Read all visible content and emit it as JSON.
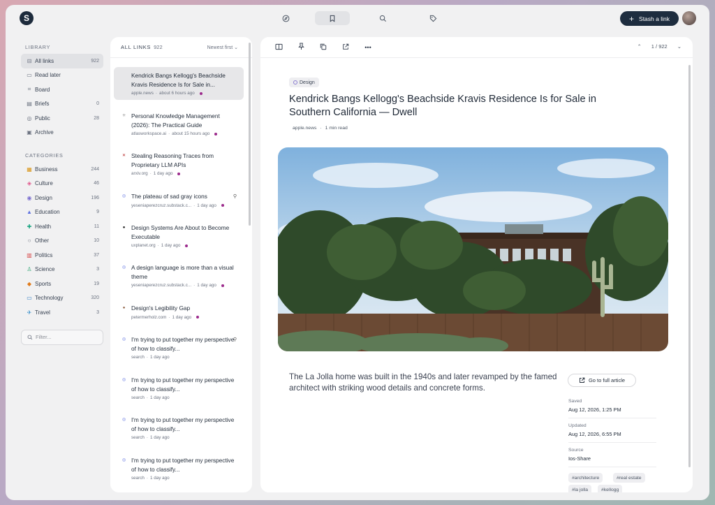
{
  "topbar": {
    "logo": "S",
    "nav_icons": [
      "compass-icon",
      "bookmark-icon",
      "search-icon",
      "tag-icon"
    ],
    "stash_label": "Stash a link"
  },
  "sidebar": {
    "library_title": "LIBRARY",
    "library": [
      {
        "label": "All links",
        "count": "922",
        "icon": "⊟",
        "active": true
      },
      {
        "label": "Read later",
        "count": "",
        "icon": "▭"
      },
      {
        "label": "Board",
        "count": "",
        "icon": "⌗"
      },
      {
        "label": "Briefs",
        "count": "0",
        "icon": "▤"
      },
      {
        "label": "Public",
        "count": "28",
        "icon": "◎"
      },
      {
        "label": "Archive",
        "count": "",
        "icon": "▣"
      }
    ],
    "categories_title": "CATEGORIES",
    "categories": [
      {
        "label": "Business",
        "count": "244",
        "icon": "▦",
        "color": "#d9961a"
      },
      {
        "label": "Culture",
        "count": "46",
        "icon": "◈",
        "color": "#e0548a"
      },
      {
        "label": "Design",
        "count": "196",
        "icon": "◉",
        "color": "#7b6fd0"
      },
      {
        "label": "Education",
        "count": "9",
        "icon": "▲",
        "color": "#5b6fe0"
      },
      {
        "label": "Health",
        "count": "11",
        "icon": "✚",
        "color": "#16a37f"
      },
      {
        "label": "Other",
        "count": "10",
        "icon": "○",
        "color": "#6b7280"
      },
      {
        "label": "Politics",
        "count": "37",
        "icon": "▥",
        "color": "#d64545"
      },
      {
        "label": "Science",
        "count": "3",
        "icon": "♙",
        "color": "#22a06b"
      },
      {
        "label": "Sports",
        "count": "19",
        "icon": "◆",
        "color": "#e07a1a"
      },
      {
        "label": "Technology",
        "count": "320",
        "icon": "▭",
        "color": "#3b82c4"
      },
      {
        "label": "Travel",
        "count": "3",
        "icon": "✈",
        "color": "#2f8bc9"
      }
    ],
    "filter_placeholder": "Filter..."
  },
  "list": {
    "title": "ALL LINKS",
    "count": "922",
    "sort": "Newest first",
    "items": [
      {
        "title": "Kendrick Bangs Kellogg's Beachside Kravis Residence Is for Sale in...",
        "source": "apple.news",
        "time": "about 6 hours ago",
        "dot": true,
        "fav": "",
        "fav_color": "#111",
        "active": true
      },
      {
        "title": "Personal Knowledge Management (2026): The Practical Guide",
        "source": "atlasworkspace.ai",
        "time": "about 15 hours ago",
        "dot": true,
        "fav": "✳",
        "fav_color": "#999"
      },
      {
        "title": "Stealing Reasoning Traces from Proprietary LLM APIs",
        "source": "arxiv.org",
        "time": "1 day ago",
        "dot": true,
        "fav": "✕",
        "fav_color": "#b31b1b"
      },
      {
        "title": "The plateau of sad gray icons",
        "source": "yeseniaperezcruz.substack.c...",
        "time": "1 day ago",
        "dot": true,
        "fav": "◎",
        "fav_color": "#5b6fe0",
        "pin": true
      },
      {
        "title": "Design Systems Are About to Become Executable",
        "source": "uxplanet.org",
        "time": "1 day ago",
        "dot": true,
        "fav": "●",
        "fav_color": "#111"
      },
      {
        "title": "A design language is more than a visual theme",
        "source": "yeseniaperezcruz.substack.c...",
        "time": "1 day ago",
        "dot": true,
        "fav": "◎",
        "fav_color": "#5b6fe0"
      },
      {
        "title": "Design's Legibility Gap",
        "source": "petermerholz.com",
        "time": "1 day ago",
        "dot": true,
        "fav": "●",
        "fav_color": "#8b5a3c"
      },
      {
        "title": "I'm trying to put together my perspective of how to classify...",
        "source": "search",
        "time": "1 day ago",
        "dot": false,
        "fav": "◎",
        "fav_color": "#5b6fe0",
        "pin": true
      },
      {
        "title": "I'm trying to put together my perspective of how to classify...",
        "source": "search",
        "time": "1 day ago",
        "dot": false,
        "fav": "◎",
        "fav_color": "#5b6fe0"
      },
      {
        "title": "I'm trying to put together my perspective of how to classify...",
        "source": "search",
        "time": "1 day ago",
        "dot": false,
        "fav": "◎",
        "fav_color": "#5b6fe0"
      },
      {
        "title": "I'm trying to put together my perspective of how to classify...",
        "source": "search",
        "time": "1 day ago",
        "dot": false,
        "fav": "◎",
        "fav_color": "#5b6fe0"
      }
    ]
  },
  "detail": {
    "toolbar_icons": [
      "reader-icon",
      "pin-icon",
      "copy-icon",
      "open-external-icon",
      "more-icon"
    ],
    "pager": "1 / 922",
    "category": "Design",
    "title": "Kendrick Bangs Kellogg's Beachside Kravis Residence Is for Sale in Southern California — Dwell",
    "source": "apple.news",
    "read_time": "1 min read",
    "description": "The La Jolla home was built in the 1940s and later revamped by the famed architect with striking wood details and concrete forms.",
    "full_article_label": "Go to full article",
    "saved_label": "Saved",
    "saved_value": "Aug 12, 2026, 1:25 PM",
    "updated_label": "Updated",
    "updated_value": "Aug 12, 2026, 6:55 PM",
    "source_label": "Source",
    "source_value": "Ios-Share",
    "tags": [
      "#architecture",
      "#real estate",
      "#la jolla",
      "#kellogg"
    ]
  }
}
